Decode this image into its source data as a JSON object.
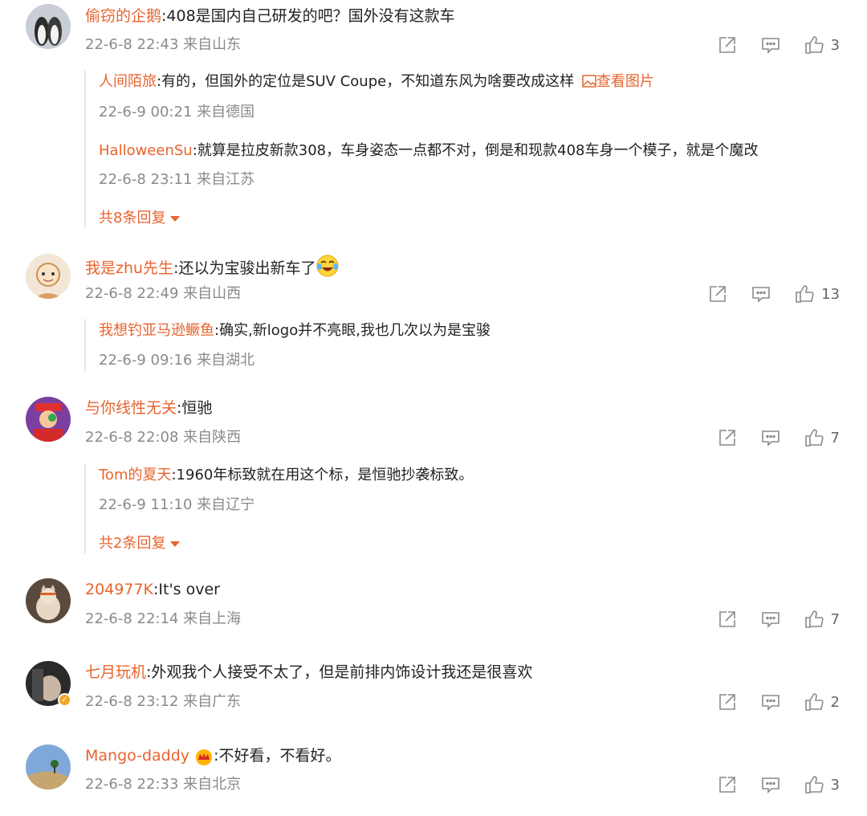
{
  "comments": [
    {
      "user": "偷窃的企鹅",
      "text": ":408是国内自己研发的吧？国外没有这款车",
      "meta": "22-6-8 22:43 来自山东",
      "likes": "3",
      "replies": [
        {
          "user": "人间陌旅",
          "text": ":有的，但国外的定位是SUV Coupe，不知道东风为啥要改成这样",
          "link": "查看图片",
          "meta": "22-6-9 00:21 来自德国"
        },
        {
          "user": "HalloweenSu",
          "text": ":就算是拉皮新款308，车身姿态一点都不对，倒是和现款408车身一个模子，就是个魔改",
          "meta": "22-6-8 23:11 来自江苏"
        }
      ],
      "more": "共8条回复"
    },
    {
      "user": "我是zhu先生",
      "text": ":还以为宝骏出新车了",
      "meta": "22-6-8 22:49 来自山西",
      "likes": "13",
      "replies": [
        {
          "user": "我想钓亚马逊鳜鱼",
          "text": ":确实,新logo并不亮眼,我也几次以为是宝骏",
          "meta": "22-6-9 09:16 来自湖北"
        }
      ]
    },
    {
      "user": "与你线性无关",
      "text": ":恒驰",
      "meta": "22-6-8 22:08 来自陕西",
      "likes": "7",
      "replies": [
        {
          "user": "Tom的夏天",
          "text": ":1960年标致就在用这个标，是恒驰抄袭标致。",
          "meta": "22-6-9 11:10 来自辽宁"
        }
      ],
      "more": "共2条回复"
    },
    {
      "user": "204977K",
      "text": ":It's over",
      "meta": "22-6-8 22:14 来自上海",
      "likes": "7"
    },
    {
      "user": "七月玩机",
      "text": ":外观我个人接受不太了，但是前排内饰设计我还是很喜欢",
      "meta": "22-6-8 23:12 来自广东",
      "likes": "2"
    },
    {
      "user": "Mango-daddy",
      "text": ":不好看，不看好。",
      "meta": "22-6-8 22:33 来自北京",
      "likes": "3"
    }
  ],
  "colors": {
    "username": "#e8642f",
    "meta": "#8a8a8a",
    "icon": "#8a8a8a"
  },
  "icons": {
    "share": "share-icon",
    "comment": "comment-icon",
    "like": "like-icon",
    "image": "image-icon",
    "verified": "verified-badge-icon",
    "crown": "crown-icon",
    "laugh": "laughing-emoji-icon"
  }
}
